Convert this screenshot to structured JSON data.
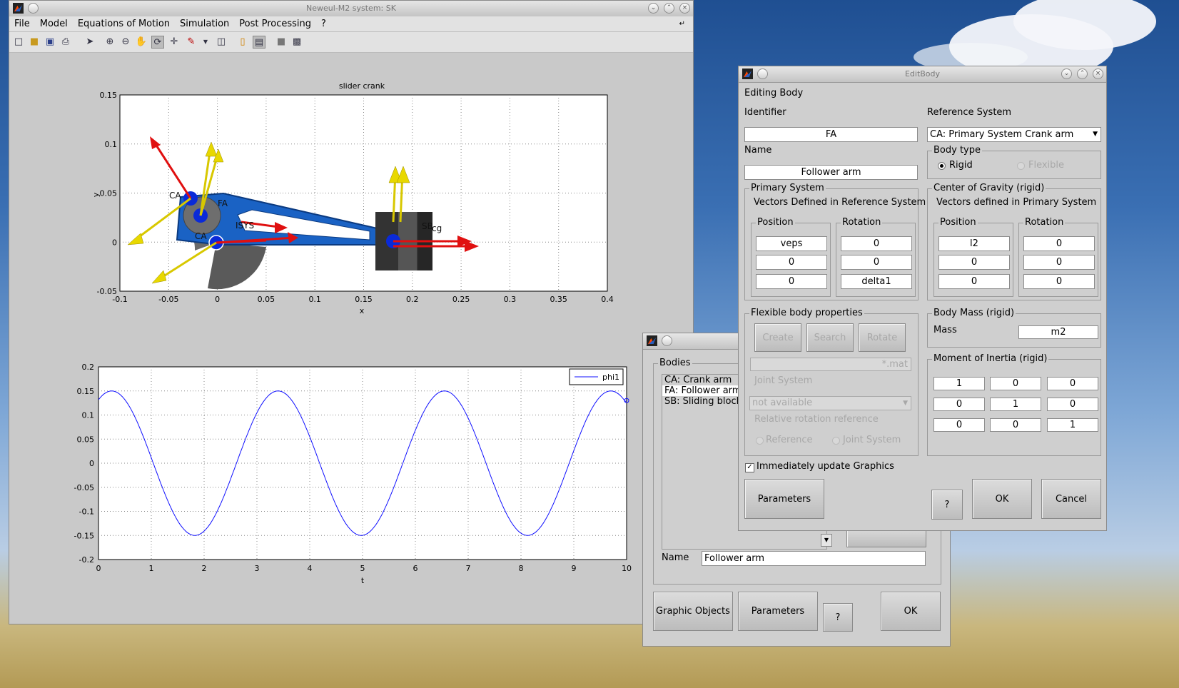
{
  "main_window": {
    "title": "Neweul-M2 system: SK",
    "menu": [
      "File",
      "Model",
      "Equations of Motion",
      "Simulation",
      "Post Processing",
      "?"
    ]
  },
  "top_plot": {
    "title": "slider crank",
    "xlabel": "x",
    "ylabel": "y",
    "xticks": [
      "-0.1",
      "-0.05",
      "0",
      "0.05",
      "0.1",
      "0.15",
      "0.2",
      "0.25",
      "0.3",
      "0.35",
      "0.4"
    ],
    "yticks": [
      "0.15",
      "0.1",
      "0.05",
      "0",
      "-0.05"
    ],
    "body_labels": [
      "CA",
      "FA",
      "CA",
      "ISYS",
      "SB",
      "cg"
    ]
  },
  "chart_data": {
    "type": "line",
    "title": "",
    "xlabel": "t",
    "ylabel": "",
    "xlim": [
      0,
      10
    ],
    "ylim": [
      -0.2,
      0.2
    ],
    "xticks": [
      "0",
      "1",
      "2",
      "3",
      "4",
      "5",
      "6",
      "7",
      "8",
      "9",
      "10"
    ],
    "yticks": [
      "0.2",
      "0.15",
      "0.1",
      "0.05",
      "0",
      "-0.05",
      "-0.1",
      "-0.15",
      "-0.2"
    ],
    "legend": "top-right",
    "grid": true,
    "series": [
      {
        "name": "phi1",
        "color": "#1010ff",
        "amplitude": 0.15,
        "period": 3.15,
        "phase_peak_t": 0.25,
        "x_end": 10,
        "y_end": 0.13
      }
    ]
  },
  "bodies_window": {
    "group_label": "Bodies",
    "items": [
      "CA: Crank arm",
      "FA: Follower arm",
      "SB: Sliding block"
    ],
    "name_label": "Name",
    "name_value": "Follower arm",
    "buttons": {
      "graphic_objects": "Graphic Objects",
      "parameters": "Parameters",
      "help": "?",
      "ok": "OK"
    }
  },
  "edit_body": {
    "title": "EditBody",
    "heading": "Editing Body",
    "identifier_label": "Identifier",
    "identifier_value": "FA",
    "name_label": "Name",
    "name_value": "Follower arm",
    "reference_system_label": "Reference System",
    "reference_system_value": "CA: Primary System Crank arm",
    "body_type": {
      "label": "Body type",
      "rigid": "Rigid",
      "flexible": "Flexible"
    },
    "primary_system": {
      "label": "Primary System",
      "subtitle": "Vectors Defined in Reference System",
      "position_label": "Position",
      "rotation_label": "Rotation",
      "position": [
        "veps",
        "0",
        "0"
      ],
      "rotation": [
        "0",
        "0",
        "delta1"
      ]
    },
    "center_of_gravity": {
      "label": "Center of Gravity (rigid)",
      "subtitle": "Vectors defined in Primary System",
      "position_label": "Position",
      "rotation_label": "Rotation",
      "position": [
        "l2",
        "0",
        "0"
      ],
      "rotation": [
        "0",
        "0",
        "0"
      ]
    },
    "flexible": {
      "label": "Flexible body properties",
      "create": "Create",
      "search": "Search",
      "rotate": "Rotate",
      "file_placeholder": "*.mat",
      "joint_system_label": "Joint System",
      "joint_system_value": "not available",
      "rel_rot_label": "Relative rotation reference",
      "radio_reference": "Reference",
      "radio_joint": "Joint System"
    },
    "body_mass": {
      "label": "Body Mass (rigid)",
      "mass_label": "Mass",
      "mass_value": "m2"
    },
    "inertia": {
      "label": "Moment of Inertia (rigid)",
      "rows": [
        [
          "1",
          "0",
          "0"
        ],
        [
          "0",
          "1",
          "0"
        ],
        [
          "0",
          "0",
          "1"
        ]
      ]
    },
    "immediate_update": "Immediately update Graphics",
    "buttons": {
      "parameters": "Parameters",
      "help": "?",
      "ok": "OK",
      "cancel": "Cancel"
    }
  }
}
